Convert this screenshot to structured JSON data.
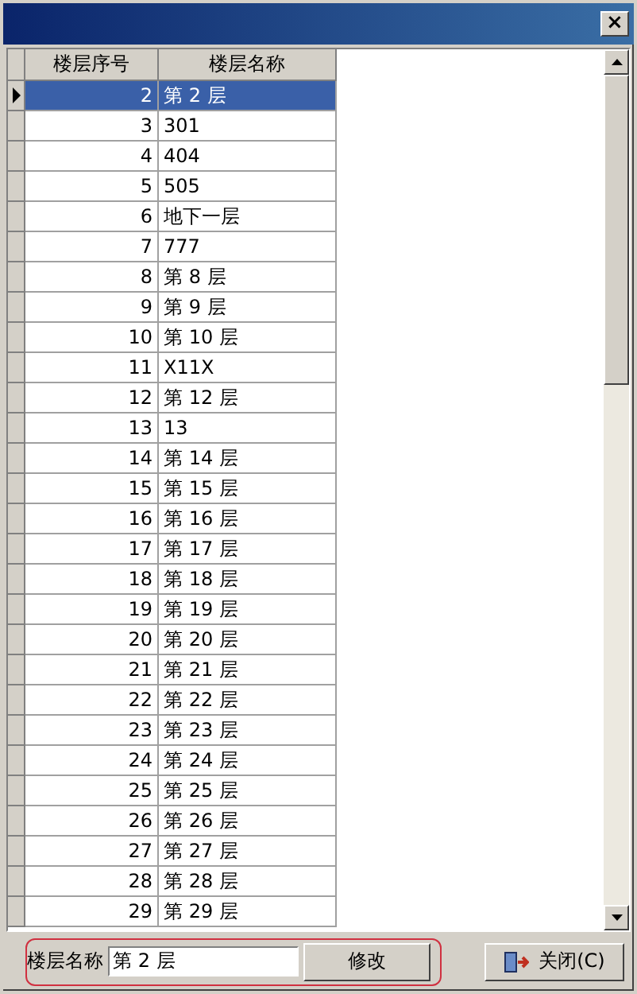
{
  "window": {
    "close_button": "×"
  },
  "table": {
    "columns": [
      "楼层序号",
      "楼层名称"
    ],
    "rows": [
      {
        "number": "2",
        "name": "第 2 层",
        "selected": true
      },
      {
        "number": "3",
        "name": "301",
        "selected": false
      },
      {
        "number": "4",
        "name": "404",
        "selected": false
      },
      {
        "number": "5",
        "name": "505",
        "selected": false
      },
      {
        "number": "6",
        "name": "地下一层",
        "selected": false
      },
      {
        "number": "7",
        "name": "777",
        "selected": false
      },
      {
        "number": "8",
        "name": "第 8 层",
        "selected": false
      },
      {
        "number": "9",
        "name": "第 9 层",
        "selected": false
      },
      {
        "number": "10",
        "name": "第 10 层",
        "selected": false
      },
      {
        "number": "11",
        "name": "X11X",
        "selected": false
      },
      {
        "number": "12",
        "name": "第 12 层",
        "selected": false
      },
      {
        "number": "13",
        "name": "13",
        "selected": false
      },
      {
        "number": "14",
        "name": "第 14 层",
        "selected": false
      },
      {
        "number": "15",
        "name": "第 15 层",
        "selected": false
      },
      {
        "number": "16",
        "name": "第 16 层",
        "selected": false
      },
      {
        "number": "17",
        "name": "第 17 层",
        "selected": false
      },
      {
        "number": "18",
        "name": "第 18 层",
        "selected": false
      },
      {
        "number": "19",
        "name": "第 19 层",
        "selected": false
      },
      {
        "number": "20",
        "name": "第 20 层",
        "selected": false
      },
      {
        "number": "21",
        "name": "第 21 层",
        "selected": false
      },
      {
        "number": "22",
        "name": "第 22 层",
        "selected": false
      },
      {
        "number": "23",
        "name": "第 23 层",
        "selected": false
      },
      {
        "number": "24",
        "name": "第 24 层",
        "selected": false
      },
      {
        "number": "25",
        "name": "第 25 层",
        "selected": false
      },
      {
        "number": "26",
        "name": "第 26 层",
        "selected": false
      },
      {
        "number": "27",
        "name": "第 27 层",
        "selected": false
      },
      {
        "number": "28",
        "name": "第 28 层",
        "selected": false
      },
      {
        "number": "29",
        "name": "第 29 层",
        "selected": false
      }
    ]
  },
  "editor": {
    "label": "楼层名称",
    "value": "第 2 层",
    "modify_button": "修改",
    "close_button": "关闭(C)"
  }
}
